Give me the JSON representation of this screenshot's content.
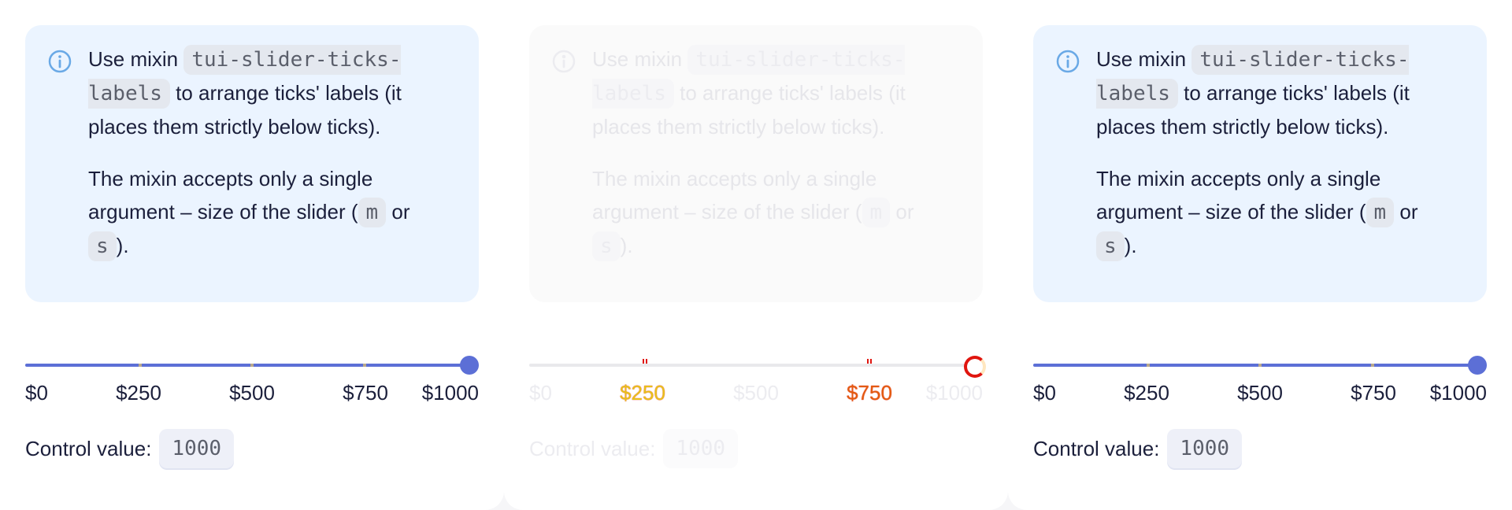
{
  "panels": [
    {
      "notice": {
        "p1_before": "Use mixin ",
        "p1_code": "tui-slider-ticks-labels",
        "p1_after": " to arrange ticks' labels (it places them strictly below ticks).",
        "p2_before": "The mixin accepts only a single argument – size of the slider (",
        "p2_code1": "m",
        "p2_mid": " or ",
        "p2_code2": "s",
        "p2_after": ")."
      },
      "slider": {
        "min": 0,
        "max": 1000,
        "value": 1000,
        "ticks": 5
      },
      "labels": [
        "$0",
        "$250",
        "$500",
        "$750",
        "$1000"
      ],
      "control": {
        "label": "Control value:",
        "value": "1000"
      }
    },
    {
      "notice": {
        "p1_before": "Use mixin ",
        "p1_code": "tui-slider-ticks-labels",
        "p1_after": " to arrange ticks' labels (it places them strictly below ticks).",
        "p2_before": "The mixin accepts only a single argument – size of the slider (",
        "p2_code1": "m",
        "p2_mid": " or ",
        "p2_code2": "s",
        "p2_after": ")."
      },
      "slider": {
        "min": 0,
        "max": 1000,
        "value": 1000,
        "ticks": 5,
        "disabled": true
      },
      "labels": [
        "$0",
        "$250",
        "$500",
        "$750",
        "$1000"
      ],
      "control": {
        "label": "Control value:",
        "value": "1000"
      }
    },
    {
      "notice": {
        "p1_before": "Use mixin ",
        "p1_code": "tui-slider-ticks-labels",
        "p1_after": " to arrange ticks' labels (it places them strictly below ticks).",
        "p2_before": "The mixin accepts only a single argument – size of the slider (",
        "p2_code1": "m",
        "p2_mid": " or ",
        "p2_code2": "s",
        "p2_after": ")."
      },
      "slider": {
        "min": 0,
        "max": 1000,
        "value": 1000,
        "ticks": 5
      },
      "labels": [
        "$0",
        "$250",
        "$500",
        "$750",
        "$1000"
      ],
      "control": {
        "label": "Control value:",
        "value": "1000"
      }
    }
  ],
  "colors": {
    "accent": "#5c6fd6",
    "notice_bg": "#ebf4ff",
    "info_icon": "#6aa9e6",
    "disabled_text": "#ececf0",
    "focus_red": "#e0150f"
  },
  "icons": {
    "notice": "info-circle-icon"
  }
}
